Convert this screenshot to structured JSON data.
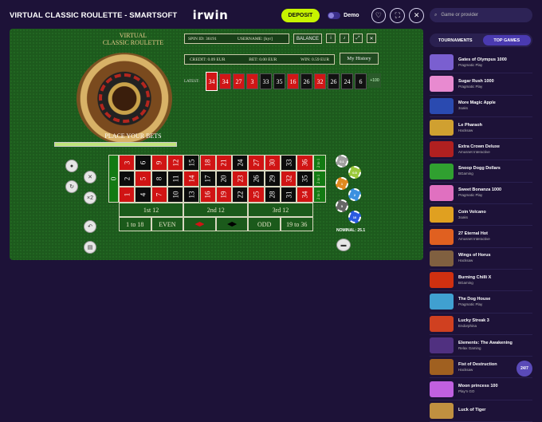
{
  "header": {
    "title": "VIRTUAL CLASSIC ROULETTE - SMARTSOFT",
    "logo": "irwin",
    "deposit": "DEPOSIT",
    "demo": "Demo"
  },
  "game": {
    "wheel_title_1": "VIRTUAL",
    "wheel_title_2": "CLASSIC ROULETTE",
    "place_bets": "PLACE YOUR BETS",
    "progress_percent": 100,
    "spin_id": "SPIN ID: 36191",
    "username": "USERNAME: [kyr]",
    "balance": "BALANCE",
    "credit": "CREDIT: 0.09 EUR",
    "bet": "BET: 0.00 EUR",
    "win": "WIN: 0.59 EUR",
    "history": "My History",
    "latest_label": "LATEST:",
    "latest": [
      {
        "n": "34",
        "c": "r"
      },
      {
        "n": "34",
        "c": "r"
      },
      {
        "n": "27",
        "c": "r"
      },
      {
        "n": "3",
        "c": "r"
      },
      {
        "n": "33",
        "c": "b"
      },
      {
        "n": "35",
        "c": "b"
      },
      {
        "n": "16",
        "c": "r"
      },
      {
        "n": "26",
        "c": "b"
      },
      {
        "n": "32",
        "c": "r"
      },
      {
        "n": "26",
        "c": "b"
      },
      {
        "n": "24",
        "c": "b"
      },
      {
        "n": "6",
        "c": "b"
      }
    ],
    "latest_more": "+100",
    "zero": "0",
    "col_bets": [
      "2 to 1",
      "2 to 1",
      "2 to 1"
    ],
    "dozens": [
      "1st 12",
      "2nd 12",
      "3rd 12"
    ],
    "outside": [
      "1 to 18",
      "EVEN",
      "",
      "",
      "ODD",
      "19 to 36"
    ],
    "nominal": "NOMINAL: 25.1",
    "chips": [
      "0.1",
      "0.5",
      "1",
      "2",
      "5",
      "10"
    ]
  },
  "sidebar": {
    "search_placeholder": "Game or provider",
    "tabs": [
      "TOURNAMENTS",
      "TOP GAMES"
    ],
    "games": [
      {
        "name": "Gates of Olympus 1000",
        "provider": "Pragmatic Play",
        "color": "#7a5fd0"
      },
      {
        "name": "Sugar Rush 1000",
        "provider": "Pragmatic Play",
        "color": "#e88ad0"
      },
      {
        "name": "More Magic Apple",
        "provider": "3oaks",
        "color": "#2a4ab0"
      },
      {
        "name": "Le Pharaoh",
        "provider": "Hacksaw",
        "color": "#d0a030"
      },
      {
        "name": "Extra Crown Deluxe",
        "provider": "Amusnet Interactive",
        "color": "#b02020"
      },
      {
        "name": "Snoop Dogg Dollars",
        "provider": "BGaming",
        "color": "#30a030"
      },
      {
        "name": "Sweet Bonanza 1000",
        "provider": "Pragmatic Play",
        "color": "#e070c0"
      },
      {
        "name": "Coin Volcano",
        "provider": "3oaks",
        "color": "#e0a020"
      },
      {
        "name": "27 Eternal Hot",
        "provider": "Amusnet Interactive",
        "color": "#e06020"
      },
      {
        "name": "Wings of Horus",
        "provider": "Hacksaw",
        "color": "#806040"
      },
      {
        "name": "Burning Chilli X",
        "provider": "BGaming",
        "color": "#d03010"
      },
      {
        "name": "The Dog House",
        "provider": "Pragmatic Play",
        "color": "#40a0d0"
      },
      {
        "name": "Lucky Streak 3",
        "provider": "Endorphina",
        "color": "#d04020"
      },
      {
        "name": "Elements: The Awakening",
        "provider": "Relax Gaming",
        "color": "#503080"
      },
      {
        "name": "Fist of Destruction",
        "provider": "Hacksaw",
        "color": "#a06020"
      },
      {
        "name": "Moon princess 100",
        "provider": "Play'n GO",
        "color": "#c060e0"
      },
      {
        "name": "Luck of Tiger",
        "provider": "",
        "color": "#c09040"
      }
    ]
  },
  "chat_label": "24/7"
}
